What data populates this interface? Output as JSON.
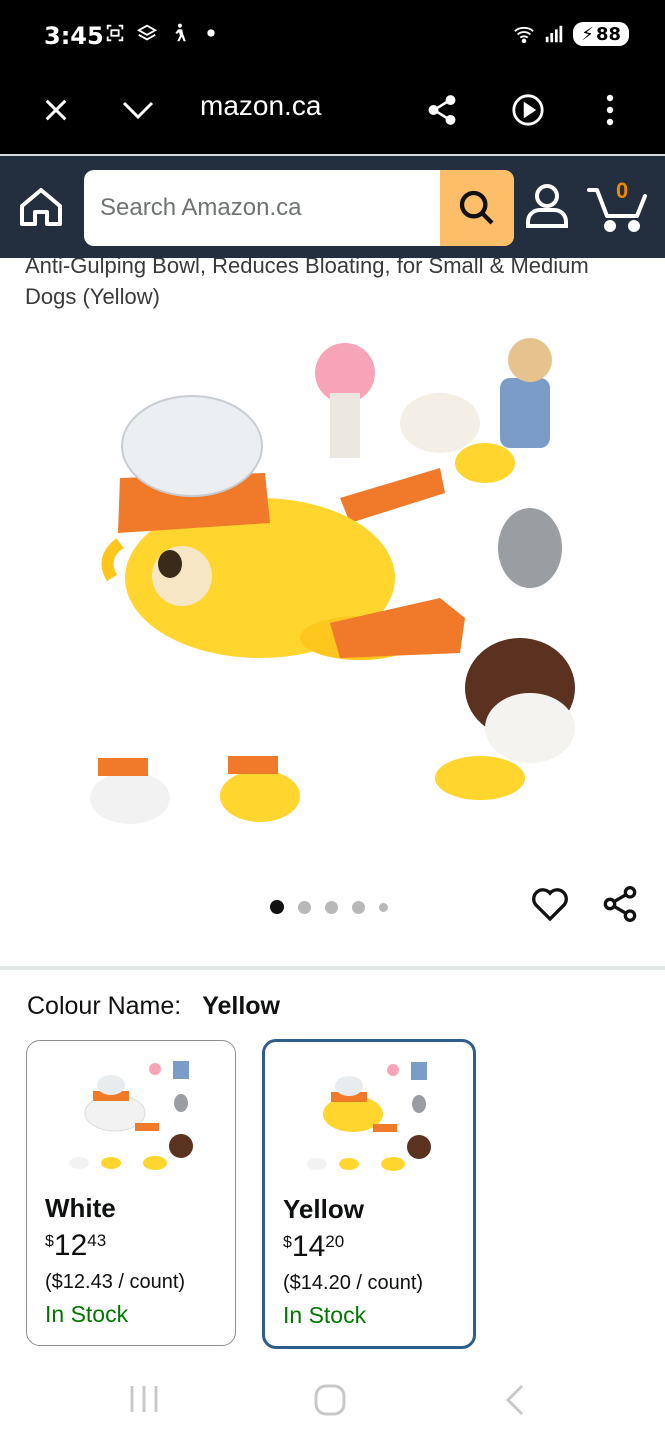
{
  "status_bar": {
    "time": "3:45",
    "battery": "88"
  },
  "browser": {
    "url": "mazon.ca"
  },
  "header": {
    "search_placeholder": "Search Amazon.ca",
    "cart_count": "0"
  },
  "product": {
    "title": "Anti-Gulping Bowl, Reduces Bloating, for Small & Medium Dogs (Yellow)",
    "image_count": 5,
    "active_image": 0
  },
  "colour": {
    "label": "Colour Name:",
    "selected": "Yellow",
    "options": [
      {
        "name": "White",
        "currency": "$",
        "whole": "12",
        "cents": "43",
        "unit_price": "($12.43 / count)",
        "stock": "In Stock"
      },
      {
        "name": "Yellow",
        "currency": "$",
        "whole": "14",
        "cents": "20",
        "unit_price": "($14.20 / count)",
        "stock": "In Stock"
      }
    ]
  },
  "colors": {
    "header_bg": "#232f3e",
    "search_button": "#febd69",
    "cart_count": "#f08804",
    "in_stock": "#007600",
    "selected_border": "#2f5d8a"
  }
}
